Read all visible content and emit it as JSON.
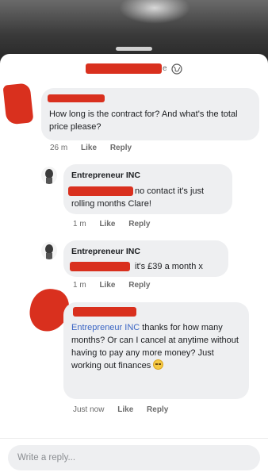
{
  "header": {
    "name_suffix": "e"
  },
  "comments": [
    {
      "text": "How long is the contract for? And what's the total price please?",
      "meta": {
        "time": "26 m",
        "like": "Like",
        "reply": "Reply"
      }
    },
    {
      "author": "Entrepreneur INC",
      "text": "no contact it's just rolling months Clare!",
      "meta": {
        "time": "1 m",
        "like": "Like",
        "reply": "Reply"
      }
    },
    {
      "author": "Entrepreneur INC",
      "text": "it's £39 a month x",
      "meta": {
        "time": "1 m",
        "like": "Like",
        "reply": "Reply"
      }
    },
    {
      "mention": "Entrepreneur INC",
      "text": "thanks for how many months? Or can I cancel at anytime without having to pay any more money? Just working out finances",
      "meta": {
        "time": "Just now",
        "like": "Like",
        "reply": "Reply"
      }
    }
  ],
  "composer": {
    "placeholder": "Write a reply..."
  },
  "colors": {
    "redaction": "#d9301e",
    "bubble": "#eeeff1",
    "mention": "#3b66c4"
  },
  "icons": [
    "globe-icon",
    "avatar-icon",
    "sweat-smile-emoji"
  ]
}
